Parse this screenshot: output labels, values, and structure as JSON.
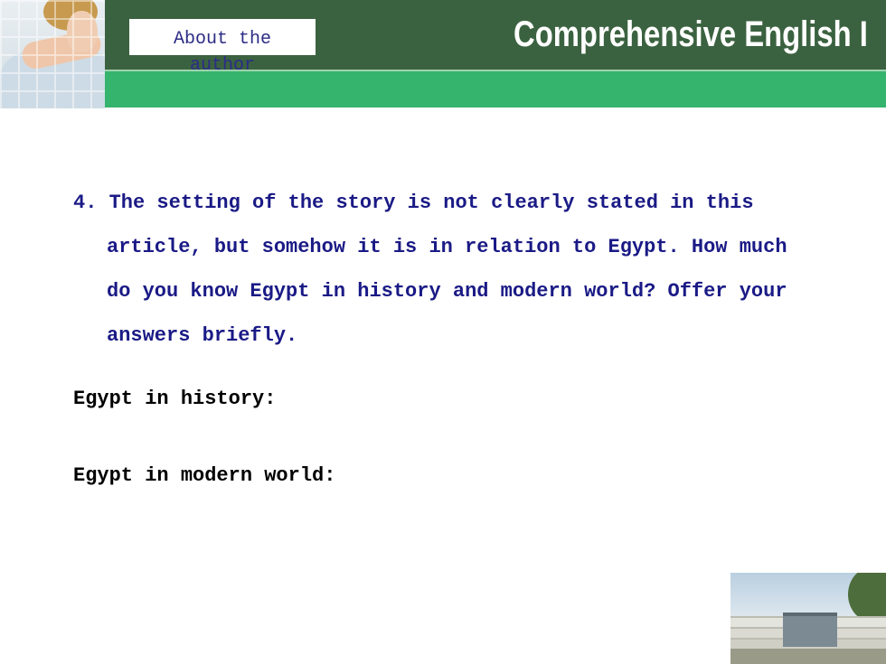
{
  "header": {
    "about_button": "About the author",
    "about_line1": "About the",
    "about_line2": "author",
    "title": "Comprehensive English I"
  },
  "question": {
    "number": "4.",
    "line1": "4. The setting of the story is not clearly stated in this",
    "line2": "article, but somehow it is in relation to Egypt. How much",
    "line3": "do you know Egypt in history and modern world? Offer your",
    "line4": "answers briefly."
  },
  "prompts": {
    "history": "Egypt in history:",
    "modern": "Egypt in modern world:"
  },
  "colors": {
    "header_dark": "#3b6240",
    "header_green": "#35b46e",
    "question_text": "#1a1a86",
    "about_text": "#2c2c86"
  },
  "icons": {
    "header_photo": "woman-photo",
    "footer_photo": "building-photo"
  }
}
